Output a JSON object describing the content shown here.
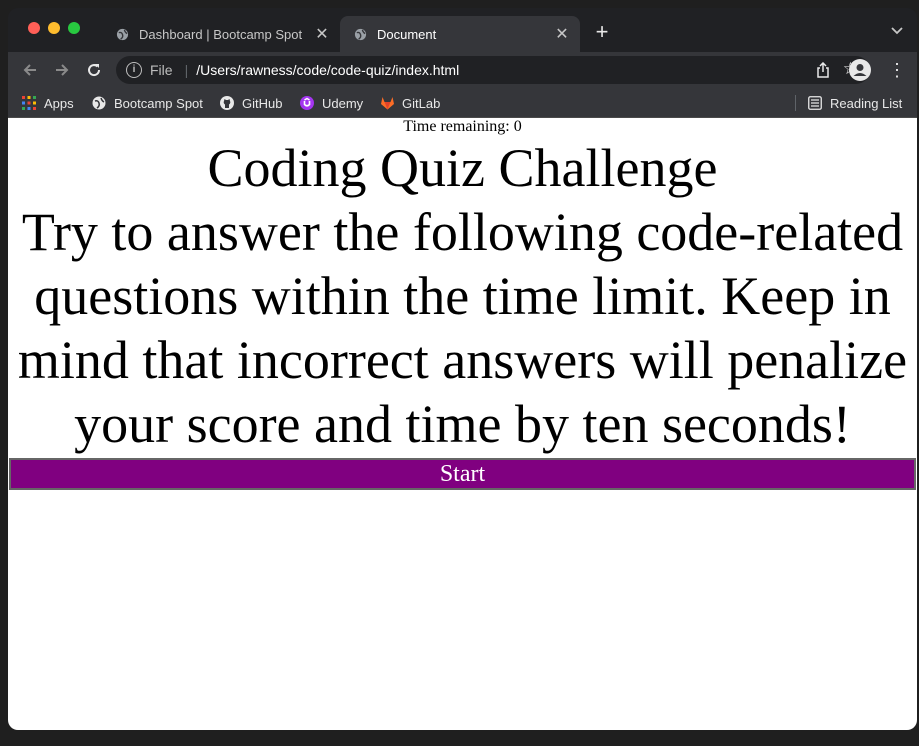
{
  "browser": {
    "tabs": [
      {
        "label": "Dashboard | Bootcamp Spot",
        "active": false
      },
      {
        "label": "Document",
        "active": true
      }
    ],
    "address": {
      "scheme_label": "File",
      "url": "/Users/rawness/code/code-quiz/index.html"
    },
    "bookmarks": [
      {
        "label": "Apps",
        "icon": "apps-grid-icon"
      },
      {
        "label": "Bootcamp Spot",
        "icon": "globe-icon"
      },
      {
        "label": "GitHub",
        "icon": "github-icon"
      },
      {
        "label": "Udemy",
        "icon": "udemy-icon"
      },
      {
        "label": "GitLab",
        "icon": "gitlab-icon"
      }
    ],
    "reading_list_label": "Reading List",
    "colors": {
      "traffic_red": "#ff5f57",
      "traffic_yellow": "#febc2e",
      "traffic_green": "#28c840"
    }
  },
  "page": {
    "timer_text": "Time remaining: 0",
    "title": "Coding Quiz Challenge",
    "instructions": "Try to answer the following code-related questions within the time limit. Keep in mind that incorrect answers will penalize your score and time by ten seconds!",
    "start_label": "Start",
    "start_color": "#800080"
  }
}
